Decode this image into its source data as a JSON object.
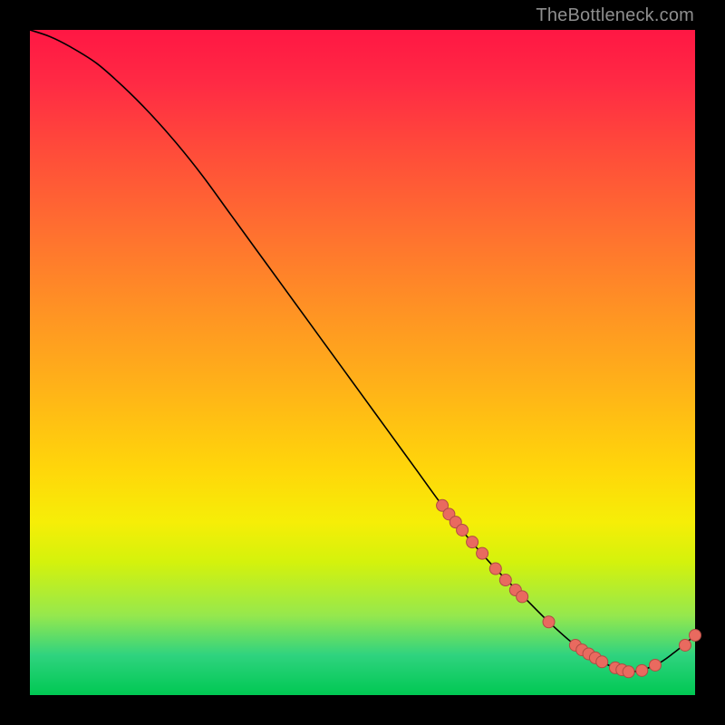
{
  "watermark": "TheBottleneck.com",
  "colors": {
    "dot_fill": "#e96a5f",
    "dot_stroke": "#b04b44",
    "curve": "#000000"
  },
  "chart_data": {
    "type": "line",
    "title": "",
    "xlabel": "",
    "ylabel": "",
    "xlim": [
      0,
      100
    ],
    "ylim": [
      0,
      100
    ],
    "grid": false,
    "series": [
      {
        "name": "curve",
        "x": [
          0,
          3,
          6,
          10,
          14,
          18,
          22,
          26,
          30,
          34,
          38,
          42,
          46,
          50,
          54,
          58,
          62,
          66,
          70,
          74,
          78,
          82,
          86,
          90,
          94,
          97,
          100
        ],
        "y": [
          100,
          99,
          97.5,
          95,
          91.5,
          87.5,
          83,
          78,
          72.5,
          67,
          61.5,
          56,
          50.5,
          45,
          39.5,
          34,
          28.5,
          23.5,
          19,
          15,
          11,
          7.5,
          5,
          3.5,
          4.5,
          6.5,
          9
        ]
      }
    ],
    "points": [
      {
        "x": 62,
        "y": 28.5
      },
      {
        "x": 63,
        "y": 27.2
      },
      {
        "x": 64,
        "y": 26.0
      },
      {
        "x": 65,
        "y": 24.8
      },
      {
        "x": 66.5,
        "y": 23.0
      },
      {
        "x": 68,
        "y": 21.3
      },
      {
        "x": 70,
        "y": 19.0
      },
      {
        "x": 71.5,
        "y": 17.3
      },
      {
        "x": 73,
        "y": 15.8
      },
      {
        "x": 74,
        "y": 14.8
      },
      {
        "x": 78,
        "y": 11.0
      },
      {
        "x": 82,
        "y": 7.5
      },
      {
        "x": 83,
        "y": 6.8
      },
      {
        "x": 84,
        "y": 6.2
      },
      {
        "x": 85,
        "y": 5.6
      },
      {
        "x": 86,
        "y": 5.0
      },
      {
        "x": 88,
        "y": 4.1
      },
      {
        "x": 89,
        "y": 3.8
      },
      {
        "x": 90,
        "y": 3.5
      },
      {
        "x": 92,
        "y": 3.7
      },
      {
        "x": 94,
        "y": 4.5
      },
      {
        "x": 98.5,
        "y": 7.5
      },
      {
        "x": 100,
        "y": 9.0
      }
    ]
  }
}
